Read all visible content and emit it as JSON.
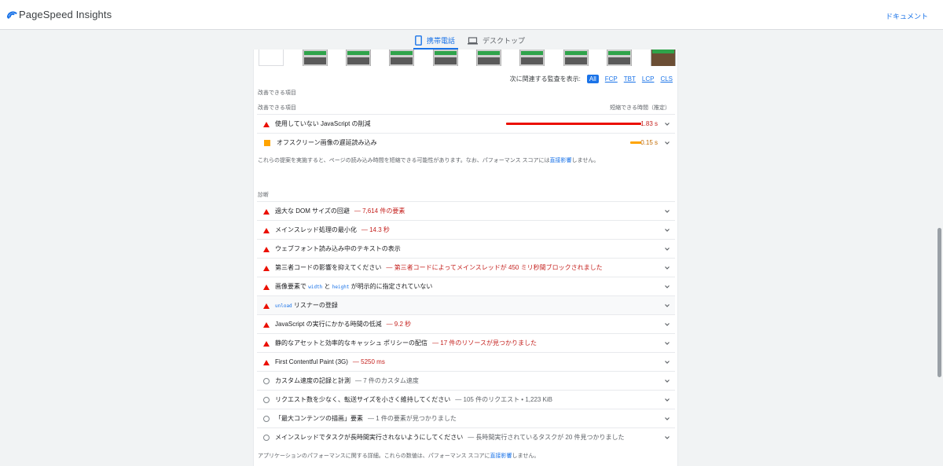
{
  "header": {
    "brand": "PageSpeed Insights",
    "doc_link": "ドキュメント"
  },
  "tabs": [
    {
      "label": "携帯電話",
      "active": true
    },
    {
      "label": "デスクトップ",
      "active": false
    }
  ],
  "filter": {
    "label": "次に関連する監査を表示:",
    "chips": [
      "All",
      "FCP",
      "TBT",
      "LCP",
      "CLS"
    ],
    "active": "All"
  },
  "opportunities": {
    "section_label": "改善できる項目",
    "column_label": "改善できる項目",
    "estimate_label": "短縮できる時間（推定）",
    "items": [
      {
        "title": "使用していない JavaScript の削減",
        "value": "1.83 s",
        "savings_fraction": 1.0,
        "color": "#eb0f00",
        "severity": "fail"
      },
      {
        "title": "オフスクリーン画像の遅延読み込み",
        "value": "0.15 s",
        "savings_fraction": 0.08,
        "color": "#ffa400",
        "severity": "average"
      }
    ],
    "note_pre": "これらの提案を実施すると、ページの読み込み時間を短縮できる可能性があります。なお、パフォーマンス スコアには",
    "note_link": "直接影響",
    "note_post": "しません。"
  },
  "diagnostics": {
    "section_label": "診断",
    "items": [
      {
        "title": "過大な DOM サイズの回避",
        "detail": "— 7,614 件の要素",
        "severity": "fail"
      },
      {
        "title": "メインスレッド処理の最小化",
        "detail": "— 14.3 秒",
        "severity": "fail"
      },
      {
        "title": "ウェブフォント読み込み中のテキストの表示",
        "detail": "",
        "severity": "fail"
      },
      {
        "title": "第三者コードの影響を抑えてください",
        "detail": "— 第三者コードによってメインスレッドが 450 ミリ秒間ブロックされました",
        "severity": "fail"
      },
      {
        "title_pre": "画像要素で ",
        "code1": "width",
        "title_mid": " と ",
        "code2": "height",
        "title_post": " が明示的に指定されていない",
        "detail": "",
        "severity": "fail",
        "kind": "code2"
      },
      {
        "code1": "unload",
        "title_post": " リスナーの登録",
        "detail": "",
        "severity": "fail",
        "kind": "code1",
        "shaded": true
      },
      {
        "title": "JavaScript の実行にかかる時間の低減",
        "detail": "— 9.2 秒",
        "severity": "fail"
      },
      {
        "title": "静的なアセットと効率的なキャッシュ ポリシーの配信",
        "detail": "— 17 件のリソースが見つかりました",
        "severity": "fail"
      },
      {
        "title": "First Contentful Paint (3G)",
        "detail": "— 5250 ms",
        "severity": "fail"
      },
      {
        "title": "カスタム速度の記録と計測",
        "detail": "— 7 件のカスタム速度",
        "severity": "info"
      },
      {
        "title": "リクエスト数を少なく、転送サイズを小さく維持してください",
        "detail": "— 105 件のリクエスト • 1,223 KiB",
        "severity": "info"
      },
      {
        "title": "「最大コンテンツの描画」要素",
        "detail": "— 1 件の要素が見つかりました",
        "severity": "info"
      },
      {
        "title": "メインスレッドでタスクが長時間実行されないようにしてください",
        "detail": "— 長時間実行されているタスクが 20 件見つかりました",
        "severity": "info"
      }
    ],
    "note_pre": "アプリケーションのパフォーマンスに関する詳細。これらの数値は、パフォーマンス スコアに",
    "note_link": "直接影響",
    "note_post": "しません。"
  },
  "colors": {
    "accent": "#1a73e8",
    "fail": "#eb0f00",
    "average": "#ffa400"
  }
}
